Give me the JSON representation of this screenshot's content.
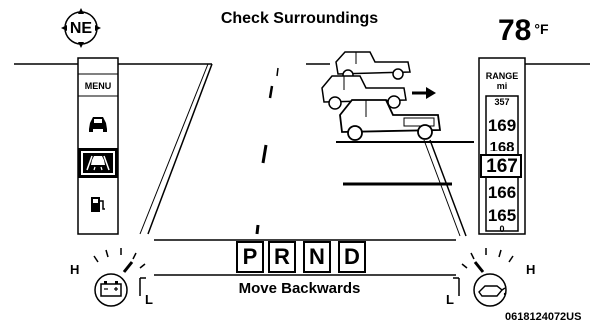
{
  "header": {
    "compass_heading": "NE",
    "message": "Check Surroundings",
    "temperature_value": "78",
    "temperature_unit": "°F"
  },
  "left_panel": {
    "menu_label": "MENU",
    "icons": [
      "car-icon",
      "lane-assist-icon",
      "fuel-pump-icon"
    ],
    "selected_index": 1
  },
  "right_panel": {
    "range_label_line1": "RANGE",
    "range_label_line2": "mi",
    "range_values": [
      "357",
      "169",
      "168",
      "167",
      "166",
      "165",
      "0"
    ],
    "selected_value": "167"
  },
  "transmission": {
    "gears": [
      "P",
      "R",
      "N",
      "D"
    ],
    "status_message": "Move Backwards"
  },
  "gauges": {
    "battery": {
      "high": "H",
      "low": "L",
      "icon": "battery-icon"
    },
    "oil": {
      "high": "H",
      "low": "L",
      "icon": "oil-can-icon"
    }
  },
  "footer_code": "0618124072US"
}
